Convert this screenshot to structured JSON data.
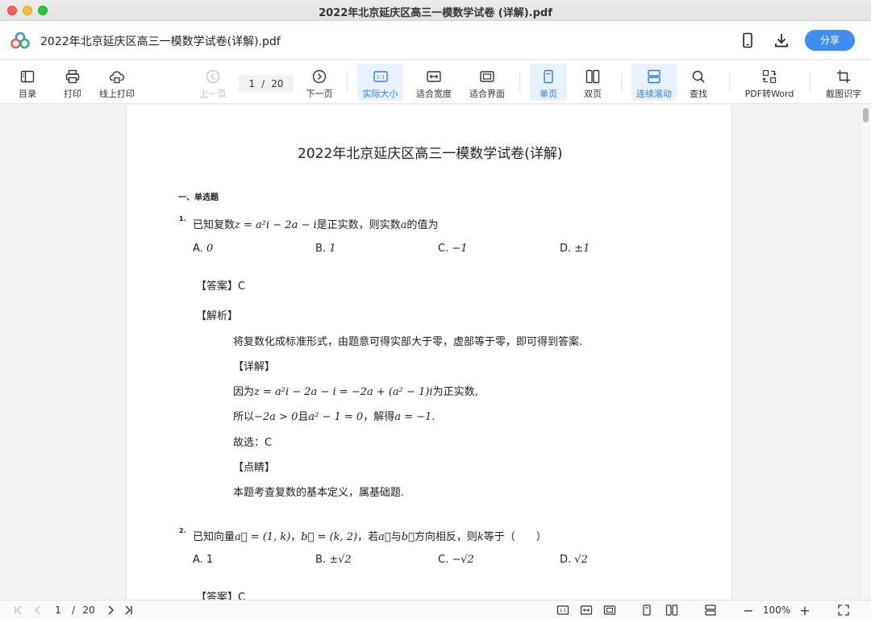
{
  "window": {
    "title": "2022年北京延庆区高三一模数学试卷 (详解).pdf"
  },
  "header": {
    "doc_title": "2022年北京延庆区高三一模数学试卷(详解).pdf",
    "share_label": "分享"
  },
  "toolbar": {
    "toc": "目录",
    "print": "打印",
    "online_print": "线上打印",
    "prev_page": "上一页",
    "current_page": "1",
    "page_sep": "/",
    "total_pages": "20",
    "next_page": "下一页",
    "actual_size": "实际大小",
    "fit_width": "适合宽度",
    "fit_page": "适合界面",
    "single_page": "单页",
    "double_page": "双页",
    "continuous": "连续滚动",
    "find": "查找",
    "pdf_to_word": "PDF转Word",
    "screenshot_ocr": "截图识字",
    "actual_size_glyph": "1:1"
  },
  "document": {
    "title": "2022年北京延庆区高三一模数学试卷(详解)",
    "section": "一、单选题",
    "q1": {
      "num": "1.",
      "stem_a": "已知复数",
      "stem_math": "z = a²i − 2a − i",
      "stem_b": "是正实数，则实数",
      "stem_var": "a",
      "stem_c": "的值为",
      "opt_a": "A. ",
      "opt_a_val": "0",
      "opt_b": "B. ",
      "opt_b_val": "1",
      "opt_c": "C. ",
      "opt_c_val": "−1",
      "opt_d": "D. ",
      "opt_d_val": "±1",
      "answer_label": "【答案】",
      "answer": "C",
      "analysis_label": "【解析】",
      "analysis": "将复数化成标准形式，由题意可得实部大于零，虚部等于零，即可得到答案.",
      "detail_label": "【详解】",
      "detail1_a": "因为",
      "detail1_math": "z = a²i − 2a − i = −2a + (a² − 1)i",
      "detail1_b": "为正实数,",
      "detail2_a": "所以",
      "detail2_m1": "−2a > 0",
      "detail2_b": "且",
      "detail2_m2": "a² − 1 = 0",
      "detail2_c": "，解得",
      "detail2_m3": "a = −1.",
      "choose": "故选：C",
      "comment_label": "【点睛】",
      "comment": "本题考查复数的基本定义，属基础题."
    },
    "q2": {
      "num": "2.",
      "stem_a": "已知向量",
      "stem_m1": "a⃗ = (1, k)",
      "stem_comma": "，",
      "stem_m2": "b⃗ = (k, 2)",
      "stem_b": "，若",
      "stem_m3": "a⃗",
      "stem_c": "与",
      "stem_m4": "b⃗",
      "stem_d": "方向相反，则",
      "stem_m5": "k",
      "stem_e": "等于（　　）",
      "opt_a": "A. 1",
      "opt_b": "B. ",
      "opt_b_val": "±√2",
      "opt_c": "C. ",
      "opt_c_val": "−√2",
      "opt_d": "D. ",
      "opt_d_val": "√2",
      "answer_label": "【答案】",
      "answer": "C"
    }
  },
  "statusbar": {
    "current_page": "1",
    "page_sep": "/",
    "total_pages": "20",
    "zoom": "100%",
    "minus": "−",
    "plus": "+"
  }
}
